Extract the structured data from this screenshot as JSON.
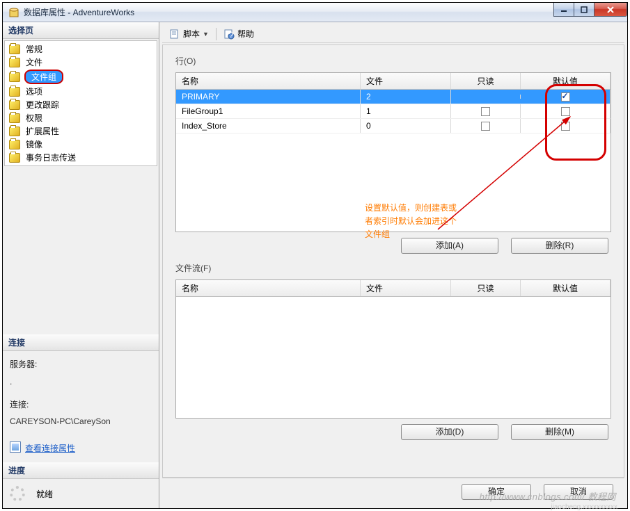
{
  "window": {
    "title": "数据库属性 - AdventureWorks"
  },
  "left_panel": {
    "select_page_header": "选择页",
    "nav_items": [
      {
        "label": "常规"
      },
      {
        "label": "文件"
      },
      {
        "label": "文件组",
        "selected": true
      },
      {
        "label": "选项"
      },
      {
        "label": "更改跟踪"
      },
      {
        "label": "权限"
      },
      {
        "label": "扩展属性"
      },
      {
        "label": "镜像"
      },
      {
        "label": "事务日志传送"
      }
    ],
    "connection_header": "连接",
    "server_label": "服务器:",
    "server_value": ".",
    "conn_label": "连接:",
    "conn_value": "CAREYSON-PC\\CareySon",
    "view_props_link": "查看连接属性",
    "progress_header": "进度",
    "progress_status": "就绪"
  },
  "toolbar": {
    "script": "脚本",
    "help": "帮助"
  },
  "main": {
    "rows_label": "行(O)",
    "filestream_label": "文件流(F)",
    "columns": {
      "name": "名称",
      "files": "文件",
      "readonly": "只读",
      "default": "默认值"
    },
    "rows": [
      {
        "name": "PRIMARY",
        "files": "2",
        "readonly": null,
        "default": true,
        "selected": true
      },
      {
        "name": "FileGroup1",
        "files": "1",
        "readonly": false,
        "default": false
      },
      {
        "name": "Index_Store",
        "files": "0",
        "readonly": false,
        "default": false
      }
    ],
    "annotation": "设置默认值，则创建表或者索引时默认会加进这个文件组",
    "add_btn": "添加(A)",
    "remove_btn": "删除(R)",
    "add_btn2": "添加(D)",
    "remove_btn2": "删除(M)"
  },
  "footer": {
    "ok": "确定",
    "cancel": "取消"
  },
  "watermark": "http://www.cnblogs.com/  教程网",
  "watermark2": "jiaocheng.xxxxxxxxxx"
}
